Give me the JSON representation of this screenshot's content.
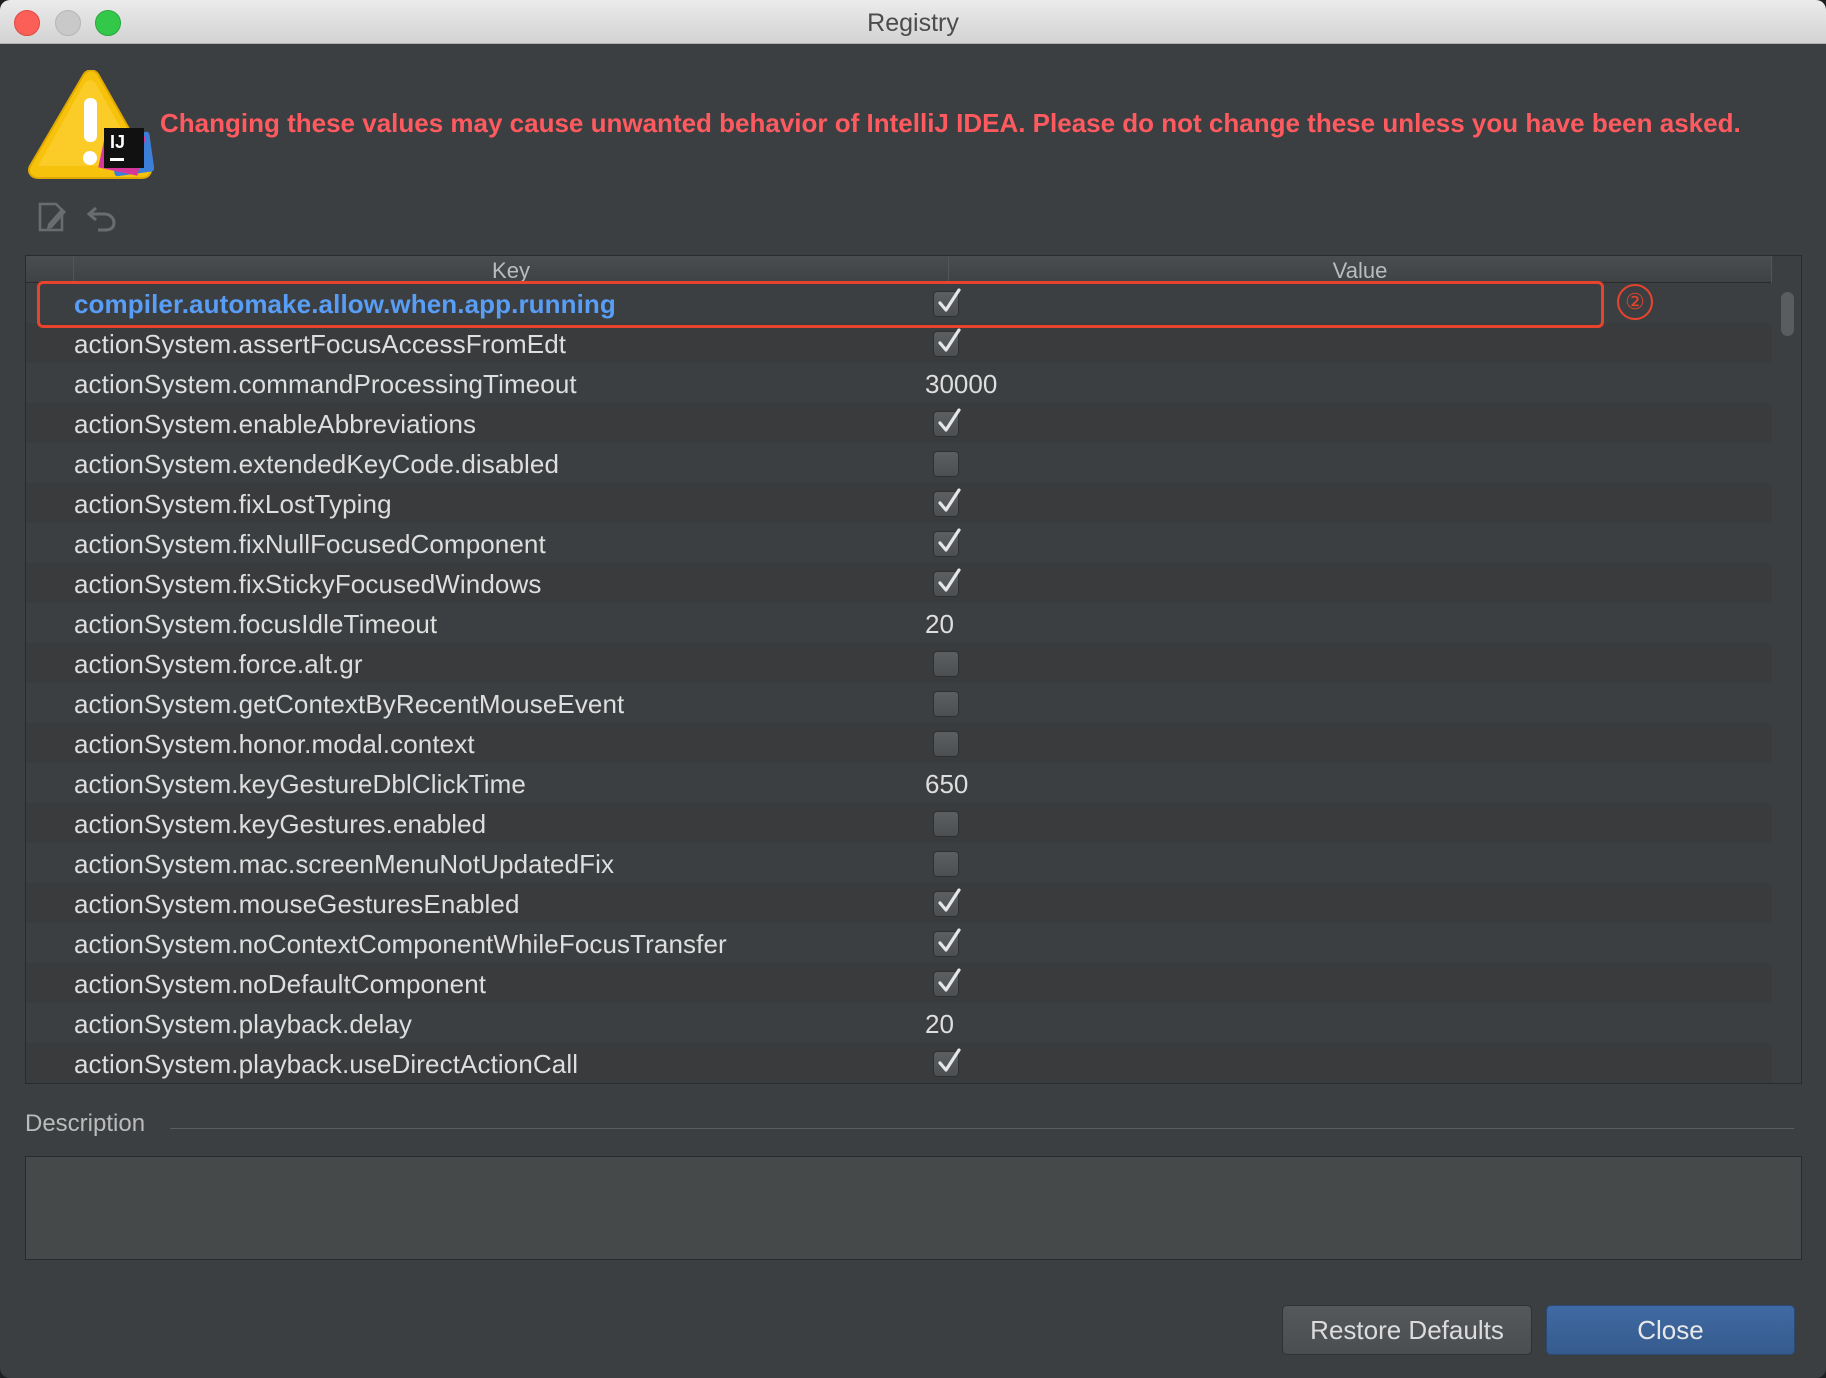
{
  "window": {
    "title": "Registry"
  },
  "warning": {
    "text": "Changing these values may cause unwanted behavior of IntelliJ IDEA. Please do not change these unless you have been asked.",
    "icon": "warning-intellij-icon",
    "color": "#ff5a5f"
  },
  "toolbar": {
    "edit_icon": "edit-icon",
    "undo_icon": "undo-icon"
  },
  "table": {
    "columns": [
      "Key",
      "Value"
    ],
    "rows": [
      {
        "key": "compiler.automake.allow.when.app.running",
        "type": "checkbox",
        "checked": true,
        "highlighted": true
      },
      {
        "key": "actionSystem.assertFocusAccessFromEdt",
        "type": "checkbox",
        "checked": true
      },
      {
        "key": "actionSystem.commandProcessingTimeout",
        "type": "text",
        "value": "30000"
      },
      {
        "key": "actionSystem.enableAbbreviations",
        "type": "checkbox",
        "checked": true
      },
      {
        "key": "actionSystem.extendedKeyCode.disabled",
        "type": "checkbox",
        "checked": false
      },
      {
        "key": "actionSystem.fixLostTyping",
        "type": "checkbox",
        "checked": true
      },
      {
        "key": "actionSystem.fixNullFocusedComponent",
        "type": "checkbox",
        "checked": true
      },
      {
        "key": "actionSystem.fixStickyFocusedWindows",
        "type": "checkbox",
        "checked": true
      },
      {
        "key": "actionSystem.focusIdleTimeout",
        "type": "text",
        "value": "20"
      },
      {
        "key": "actionSystem.force.alt.gr",
        "type": "checkbox",
        "checked": false
      },
      {
        "key": "actionSystem.getContextByRecentMouseEvent",
        "type": "checkbox",
        "checked": false
      },
      {
        "key": "actionSystem.honor.modal.context",
        "type": "checkbox",
        "checked": false
      },
      {
        "key": "actionSystem.keyGestureDblClickTime",
        "type": "text",
        "value": "650"
      },
      {
        "key": "actionSystem.keyGestures.enabled",
        "type": "checkbox",
        "checked": false
      },
      {
        "key": "actionSystem.mac.screenMenuNotUpdatedFix",
        "type": "checkbox",
        "checked": false
      },
      {
        "key": "actionSystem.mouseGesturesEnabled",
        "type": "checkbox",
        "checked": true
      },
      {
        "key": "actionSystem.noContextComponentWhileFocusTransfer",
        "type": "checkbox",
        "checked": true
      },
      {
        "key": "actionSystem.noDefaultComponent",
        "type": "checkbox",
        "checked": true
      },
      {
        "key": "actionSystem.playback.delay",
        "type": "text",
        "value": "20"
      },
      {
        "key": "actionSystem.playback.useDirectActionCall",
        "type": "checkbox",
        "checked": true
      }
    ],
    "highlight_color": "#589df6"
  },
  "annotation": {
    "number": "②",
    "color": "#e8442d"
  },
  "description": {
    "label": "Description",
    "value": ""
  },
  "buttons": {
    "restore_defaults": "Restore Defaults",
    "close": "Close"
  }
}
